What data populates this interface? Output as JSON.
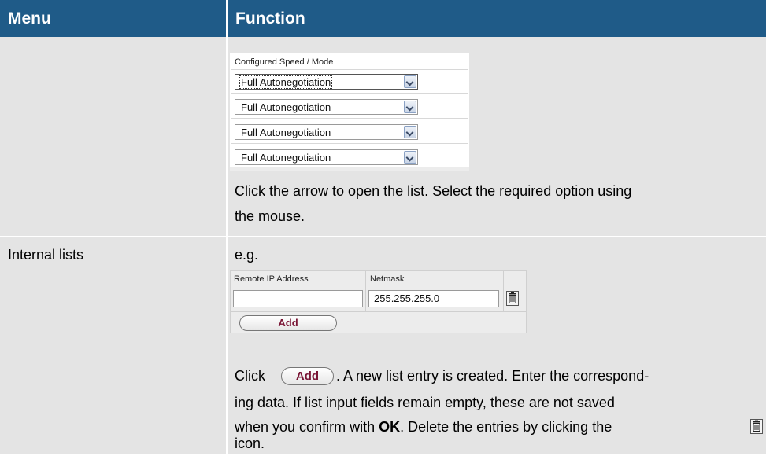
{
  "header": {
    "menu": "Menu",
    "function": "Function"
  },
  "row1": {
    "caption": "Configured Speed / Mode",
    "selects": [
      "Full Autonegotiation",
      "Full Autonegotiation",
      "Full Autonegotiation",
      "Full Autonegotiation"
    ],
    "text_line1": "Click the arrow to open the list. Select the required option using",
    "text_line2": "the mouse."
  },
  "row2": {
    "menu": "Internal lists",
    "eg": "e.g.",
    "col_remote": "Remote IP Address",
    "col_netmask": "Netmask",
    "remote_value": "",
    "netmask_value": "255.255.255.0",
    "add_label": "Add",
    "click_word": "Click",
    "line1_after": ". A new list entry is created. Enter the correspond-",
    "line2": "ing data. If list input fields remain empty, these are not saved",
    "line3_a": "when you confirm with ",
    "line3_ok": "OK",
    "line3_b": ". Delete the entries by clicking the",
    "line4": "icon."
  },
  "icons": {
    "trash": "trash-icon",
    "dropdown": "chevron-down-icon"
  },
  "colors": {
    "header_bg": "#1f5b88",
    "row_bg": "#e4e4e4",
    "add_text": "#7a1535"
  }
}
